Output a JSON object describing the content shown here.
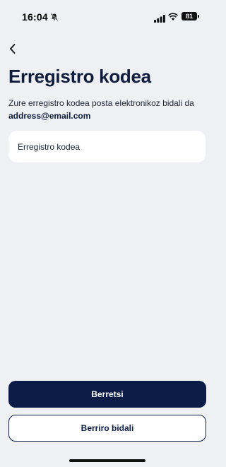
{
  "status_bar": {
    "time": "16:04",
    "battery": "81",
    "icons": [
      "bell-slash-icon",
      "cellular-signal-icon",
      "wifi-icon",
      "battery-icon"
    ]
  },
  "nav": {
    "back_icon": "chevron-left-icon"
  },
  "page": {
    "title": "Erregistro kodea",
    "description": "Zure erregistro kodea posta elektronikoz bidali da",
    "email": "address@email.com"
  },
  "form": {
    "code_placeholder": "Erregistro kodea",
    "code_value": ""
  },
  "actions": {
    "confirm_label": "Berretsi",
    "resend_label": "Berriro bidali"
  },
  "colors": {
    "background": "#eef0f3",
    "primary": "#0b1c48",
    "title": "#0e1c3d"
  }
}
